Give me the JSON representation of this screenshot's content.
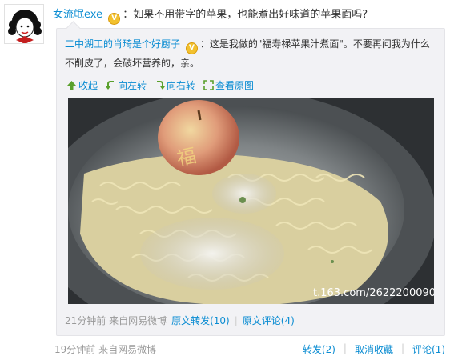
{
  "post": {
    "author": "女流氓exe",
    "text": "如果不用带字的苹果，也能煮出好味道的苹果面吗?"
  },
  "original": {
    "author": "二中湖工的肖琦是个好厨子",
    "text": "这是我做的\"福寿禄苹果汁煮面\"。不要再问我为什么不削皮了，会破坏营养的，亲。",
    "actions": {
      "collapse": "收起",
      "rotate_left": "向左转",
      "rotate_right": "向右转",
      "view_original": "查看原图"
    },
    "photo": {
      "watermark": "t.163.com/2622200090"
    },
    "meta": {
      "time": "21分钟前 来自网易微博",
      "repost": "原文转发(10)",
      "comment": "原文评论(4)"
    }
  },
  "footer": {
    "time": "19分钟前 来自网易微博",
    "repost": "转发(2)",
    "unfavorite": "取消收藏",
    "comment": "评论(1)"
  },
  "colors": {
    "link": "#0a8cd2",
    "repost_bg": "#f2f2f5",
    "vip_badge": "#f2c12e"
  },
  "icons": [
    "avatar-image",
    "vip-badge-icon",
    "collapse-arrow-icon",
    "rotate-left-icon",
    "rotate-right-icon",
    "view-original-icon"
  ]
}
